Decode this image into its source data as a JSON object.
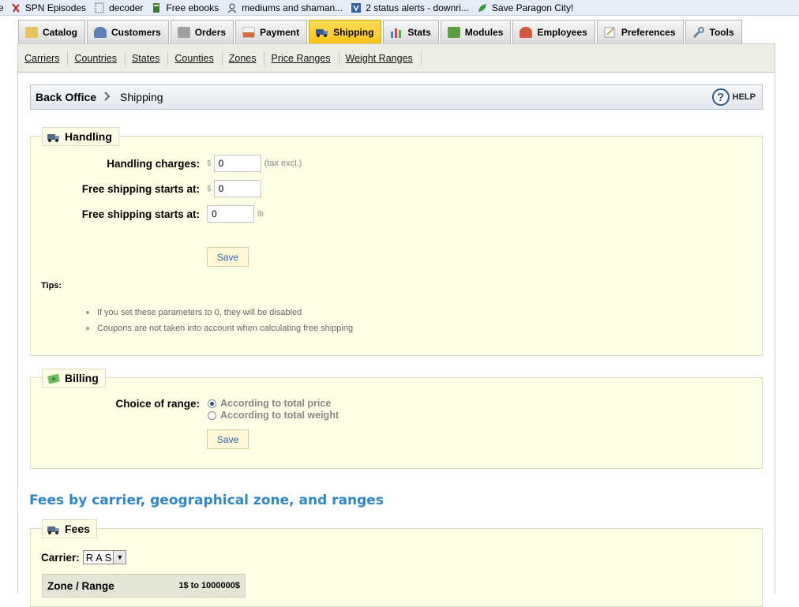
{
  "bookmarks": [
    {
      "label": "e",
      "icon": "page-icon"
    },
    {
      "label": "SPN Episodes",
      "icon": "spn-icon"
    },
    {
      "label": "decoder",
      "icon": "dotted-page-icon"
    },
    {
      "label": "Free ebooks",
      "icon": "book-icon"
    },
    {
      "label": "mediums and shaman...",
      "icon": "user-icon"
    },
    {
      "label": "2 status alerts - downri...",
      "icon": "alert-icon"
    },
    {
      "label": "Save Paragon City!",
      "icon": "leaf-icon"
    }
  ],
  "tabs": [
    {
      "label": "Catalog",
      "icon": "folder-icon",
      "color": "#e7c25a"
    },
    {
      "label": "Customers",
      "icon": "customers-icon",
      "color": "#5b7fb8"
    },
    {
      "label": "Orders",
      "icon": "cart-icon",
      "color": "#8c8c8c"
    },
    {
      "label": "Payment",
      "icon": "payment-icon",
      "color": "#d46a3a"
    },
    {
      "label": "Shipping",
      "icon": "truck-icon",
      "color": "#3c5f8f",
      "active": true
    },
    {
      "label": "Stats",
      "icon": "chart-icon",
      "color": "#4a7ec7"
    },
    {
      "label": "Modules",
      "icon": "puzzle-icon",
      "color": "#5aa03c"
    },
    {
      "label": "Employees",
      "icon": "employee-icon",
      "color": "#d2593c"
    },
    {
      "label": "Preferences",
      "icon": "preferences-icon",
      "color": "#c9a742"
    },
    {
      "label": "Tools",
      "icon": "wrench-icon",
      "color": "#6d86a8"
    }
  ],
  "subnav": [
    "Carriers",
    "Countries",
    "States",
    "Counties",
    "Zones",
    "Price Ranges",
    "Weight Ranges"
  ],
  "breadcrumb": {
    "root": "Back Office",
    "current": "Shipping",
    "help": "HELP"
  },
  "handling": {
    "legend": "Handling",
    "charges_label": "Handling charges:",
    "charges_currency": "$",
    "charges_value": "0",
    "charges_hint": "(tax excl.)",
    "free_price_label": "Free shipping starts at:",
    "free_price_currency": "$",
    "free_price_value": "0",
    "free_weight_label": "Free shipping starts at:",
    "free_weight_value": "0",
    "free_weight_unit": "lb",
    "save": "Save",
    "tips_title": "Tips:",
    "tips": [
      "If you set these parameters to 0, they will be disabled",
      "Coupons are not taken into account when calculating free shipping"
    ]
  },
  "billing": {
    "legend": "Billing",
    "choice_label": "Choice of range:",
    "options": [
      "According to total price",
      "According to total weight"
    ],
    "save": "Save"
  },
  "fees_title": "Fees by carrier, geographical zone, and ranges",
  "fees": {
    "legend": "Fees",
    "carrier_label": "Carrier:",
    "carrier_value": "R A S",
    "zone_header": "Zone / Range",
    "range_header": "1$ to 1000000$"
  }
}
